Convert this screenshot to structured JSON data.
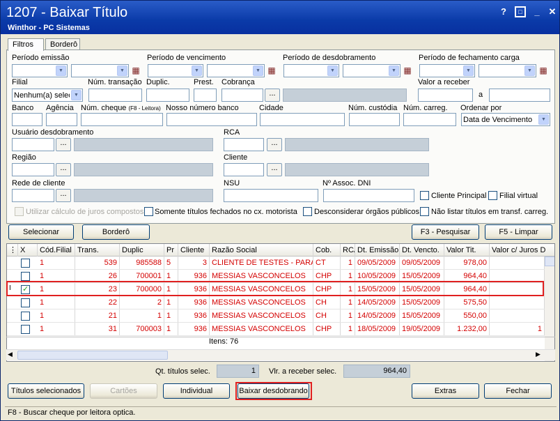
{
  "window": {
    "title": "1207 - Baixar Título",
    "subtitle": "Winthor - PC Sistemas",
    "help": "?",
    "maximize": "□",
    "close": "✕"
  },
  "tabs": [
    {
      "label": "Filtros"
    },
    {
      "label": "Borderô"
    }
  ],
  "filters": {
    "periodo_emissao": "Período emissão",
    "periodo_vencimento": "Período de vencimento",
    "periodo_desdobramento": "Período de desdobramento",
    "periodo_fechamento_carga": "Período de fechamento carga",
    "filial": "Filial",
    "filial_value": "Nenhum(a) selec",
    "num_transacao": "Núm. transação",
    "duplic": "Duplic.",
    "prest": "Prest.",
    "cobranca": "Cobrança",
    "valor_receber": "Valor a receber",
    "a": "a",
    "banco": "Banco",
    "agencia": "Agência",
    "num_cheque": "Núm. cheque",
    "num_cheque_hint": "(F8 - Leitora)",
    "nosso_numero": "Nosso número banco",
    "cidade": "Cidade",
    "num_custodia": "Núm. custódia",
    "num_carreg": "Núm. carreg.",
    "ordenar_por": "Ordenar por",
    "ordenar_value": "Data de Vencimento",
    "usuario_desdobramento": "Usuário desdobramento",
    "rca": "RCA",
    "regiao": "Região",
    "cliente": "Cliente",
    "rede_cliente": "Rede de cliente",
    "nsu": "NSU",
    "assoc_dni": "Nº Assoc. DNI",
    "cliente_principal": "Cliente Principal",
    "filial_virtual": "Filial virtual",
    "juros_compostos": "Utilizar cálculo de juros compostos",
    "somente_fechados": "Somente títulos fechados no cx. motorista",
    "desconsiderar_orgaos": "Desconsiderar órgãos públicos",
    "nao_listar_transf": "Não listar títulos em transf. carreg.",
    "ellipsis": "...",
    "dropdown_arrow": "▼",
    "calendar_icon": "▦"
  },
  "toolbar": {
    "selecionar": "Selecionar",
    "bordero": "Borderô",
    "pesquisar": "F3 - Pesquisar",
    "limpar": "F5 - Limpar"
  },
  "grid": {
    "columns": [
      "X",
      "Cód.Filial",
      "Trans.",
      "Duplic",
      "Pr",
      "Cliente",
      "Razão Social",
      "Cob.",
      "RCA",
      "Dt. Emissão",
      "Dt. Vencto.",
      "Valor Tit.",
      "Valor c/ Juros D"
    ],
    "rows": [
      {
        "filial": "1",
        "trans": "539",
        "duplic": "985588",
        "pr": "5",
        "cliente": "3",
        "razao": "CLIENTE DE TESTES - PARAME",
        "cob": "CT",
        "rca": "1",
        "emissao": "09/05/2009",
        "vencto": "09/05/2009",
        "valor": "978,00",
        "juros": "",
        "checked": false
      },
      {
        "filial": "1",
        "trans": "26",
        "duplic": "700001",
        "pr": "1",
        "cliente": "936",
        "razao": "MESSIAS VASCONCELOS",
        "cob": "CHP",
        "rca": "1",
        "emissao": "10/05/2009",
        "vencto": "15/05/2009",
        "valor": "964,40",
        "juros": "",
        "checked": false
      },
      {
        "filial": "1",
        "trans": "23",
        "duplic": "700000",
        "pr": "1",
        "cliente": "936",
        "razao": "MESSIAS VASCONCELOS",
        "cob": "CHP",
        "rca": "1",
        "emissao": "15/05/2009",
        "vencto": "15/05/2009",
        "valor": "964,40",
        "juros": "",
        "checked": true
      },
      {
        "filial": "1",
        "trans": "22",
        "duplic": "2",
        "pr": "1",
        "cliente": "936",
        "razao": "MESSIAS VASCONCELOS",
        "cob": "CH",
        "rca": "1",
        "emissao": "14/05/2009",
        "vencto": "15/05/2009",
        "valor": "575,50",
        "juros": "",
        "checked": false
      },
      {
        "filial": "1",
        "trans": "21",
        "duplic": "1",
        "pr": "1",
        "cliente": "936",
        "razao": "MESSIAS VASCONCELOS",
        "cob": "CH",
        "rca": "1",
        "emissao": "14/05/2009",
        "vencto": "15/05/2009",
        "valor": "550,00",
        "juros": "",
        "checked": false
      },
      {
        "filial": "1",
        "trans": "31",
        "duplic": "700003",
        "pr": "1",
        "cliente": "936",
        "razao": "MESSIAS VASCONCELOS",
        "cob": "CHP",
        "rca": "1",
        "emissao": "18/05/2009",
        "vencto": "19/05/2009",
        "valor": "1.232,00",
        "juros": "1",
        "checked": false
      }
    ],
    "itens": "Itens: 76",
    "selected_marker": "I"
  },
  "summary": {
    "qt_label": "Qt. títulos selec.",
    "qt_value": "1",
    "vlr_label": "Vlr. a receber selec.",
    "vlr_value": "964,40"
  },
  "bottom": {
    "titulos": "Títulos selecionados",
    "cartoes": "Cartões",
    "individual": "Individual",
    "baixar": "Baixar desdobrando",
    "extras": "Extras",
    "fechar": "Fechar"
  },
  "status": "F8 - Buscar cheque por leitora optica.",
  "accent": {
    "title": "#0a3aa8",
    "red_text": "#d40000",
    "highlight": "#e02020"
  }
}
